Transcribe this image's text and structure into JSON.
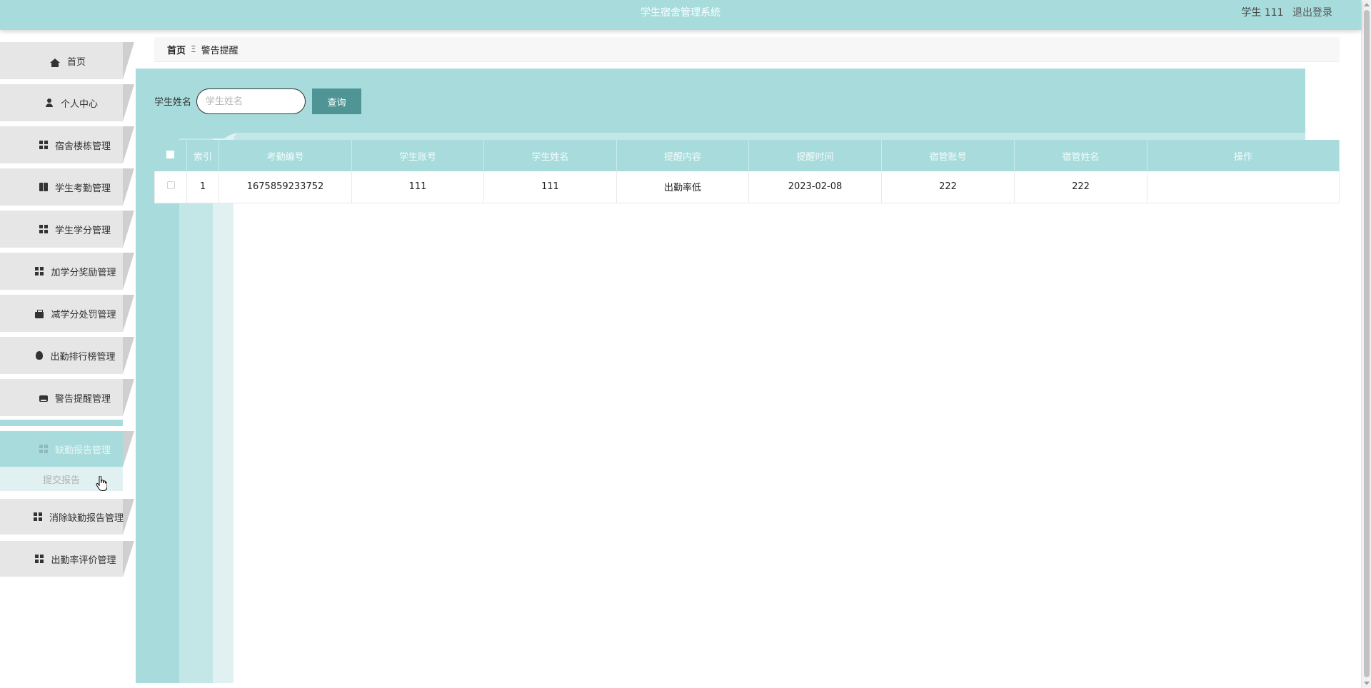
{
  "header": {
    "title": "学生宿舍管理系统",
    "user_label": "学生 111",
    "logout_label": "退出登录"
  },
  "sidebar": {
    "items": [
      {
        "label": "首页",
        "icon": "home-icon"
      },
      {
        "label": "个人中心",
        "icon": "user-icon"
      },
      {
        "label": "宿舍楼栋管理",
        "icon": "grid-icon"
      },
      {
        "label": "学生考勤管理",
        "icon": "book-icon"
      },
      {
        "label": "学生学分管理",
        "icon": "grid-icon"
      },
      {
        "label": "加学分奖励管理",
        "icon": "grid-icon"
      },
      {
        "label": "减学分处罚管理",
        "icon": "briefcase-icon"
      },
      {
        "label": "出勤排行榜管理",
        "icon": "bulb-icon"
      },
      {
        "label": "警告提醒管理",
        "icon": "print-icon"
      },
      {
        "label": "缺勤报告管理",
        "icon": "grid-icon"
      },
      {
        "label": "消除缺勤报告管理",
        "icon": "grid-icon"
      },
      {
        "label": "出勤率评价管理",
        "icon": "grid-icon"
      }
    ],
    "submenu": {
      "label": "提交报告"
    }
  },
  "breadcrumb": {
    "home": "首页",
    "separator": "Ξ",
    "current": "警告提醒"
  },
  "search": {
    "label": "学生姓名",
    "placeholder": "学生姓名",
    "value": "",
    "button_label": "查询"
  },
  "table": {
    "columns": [
      "索引",
      "考勤编号",
      "学生账号",
      "学生姓名",
      "提醒内容",
      "提醒时间",
      "宿管账号",
      "宿管姓名",
      "操作"
    ],
    "rows": [
      {
        "index": "1",
        "attendance_no": "1675859233752",
        "student_account": "111",
        "student_name": "111",
        "content": "出勤率低",
        "time": "2023-02-08",
        "manager_account": "222",
        "manager_name": "222",
        "action": ""
      }
    ]
  },
  "colors": {
    "accent": "#a8dcdc",
    "accent_light": "#c3e6e6",
    "accent_lighter": "#e1f1f1",
    "button": "#4f9595"
  }
}
